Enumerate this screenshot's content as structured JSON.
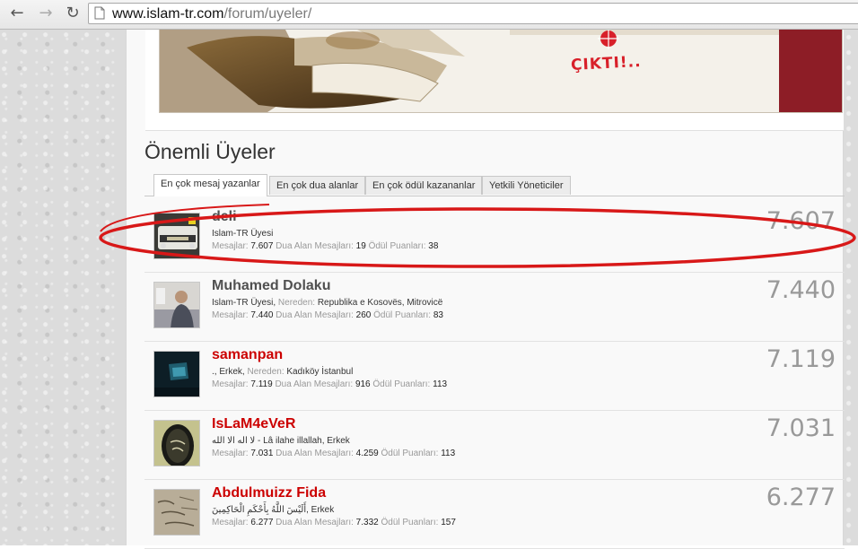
{
  "browser": {
    "url_host": "www.islam-tr.com",
    "url_path": "/forum/uyeler/"
  },
  "banner": {
    "text": "ÇIKTI!.."
  },
  "section": {
    "title": "Önemli Üyeler"
  },
  "tabs": [
    {
      "label": "En çok mesaj yazanlar",
      "active": true
    },
    {
      "label": "En çok dua alanlar",
      "active": false
    },
    {
      "label": "En çok ödül kazananlar",
      "active": false
    },
    {
      "label": "Yetkili Yöneticiler",
      "active": false
    }
  ],
  "labels": {
    "nereden": "Nereden:",
    "mesajlar": "Mesajlar:",
    "dua": "Dua Alan Mesajları:",
    "odul": "Ödül Puanları:"
  },
  "members": [
    {
      "name": "deli",
      "name_color": "gray",
      "title": "Islam-TR Üyesi",
      "extra": "",
      "location": "",
      "messages": "7.607",
      "dua": "19",
      "odul": "38",
      "count": "7.607"
    },
    {
      "name": "Muhamed Dolaku",
      "name_color": "gray",
      "title": "Islam-TR Üyesi",
      "extra": "",
      "location": "Republika e Kosovës, Mitrovicë",
      "messages": "7.440",
      "dua": "260",
      "odul": "83",
      "count": "7.440"
    },
    {
      "name": "samanpan",
      "name_color": "red",
      "title": "., Erkek",
      "extra": "",
      "location": "Kadıköy İstanbul",
      "messages": "7.119",
      "dua": "916",
      "odul": "113",
      "count": "7.119"
    },
    {
      "name": "IsLaM4eVeR",
      "name_color": "red",
      "title": "لا اله الا الله - Lâ ilahe illallah, Erkek",
      "extra": "",
      "location": "",
      "messages": "7.031",
      "dua": "4.259",
      "odul": "113",
      "count": "7.031"
    },
    {
      "name": "Abdulmuizz Fida",
      "name_color": "red",
      "title": "أَلَيْسَ اللَّهُ بِأَحْكَمِ الْحَاكِمِينَ, Erkek",
      "extra": "",
      "location": "",
      "messages": "6.277",
      "dua": "7.332",
      "odul": "157",
      "count": "6.277"
    }
  ],
  "colors": {
    "highlight_ellipse": "#d81818",
    "red_name": "#cc0000",
    "count_gray": "#999999"
  },
  "icons": {
    "back": "arrow-left-icon",
    "forward": "arrow-right-icon",
    "reload": "reload-icon",
    "page": "page-icon"
  }
}
